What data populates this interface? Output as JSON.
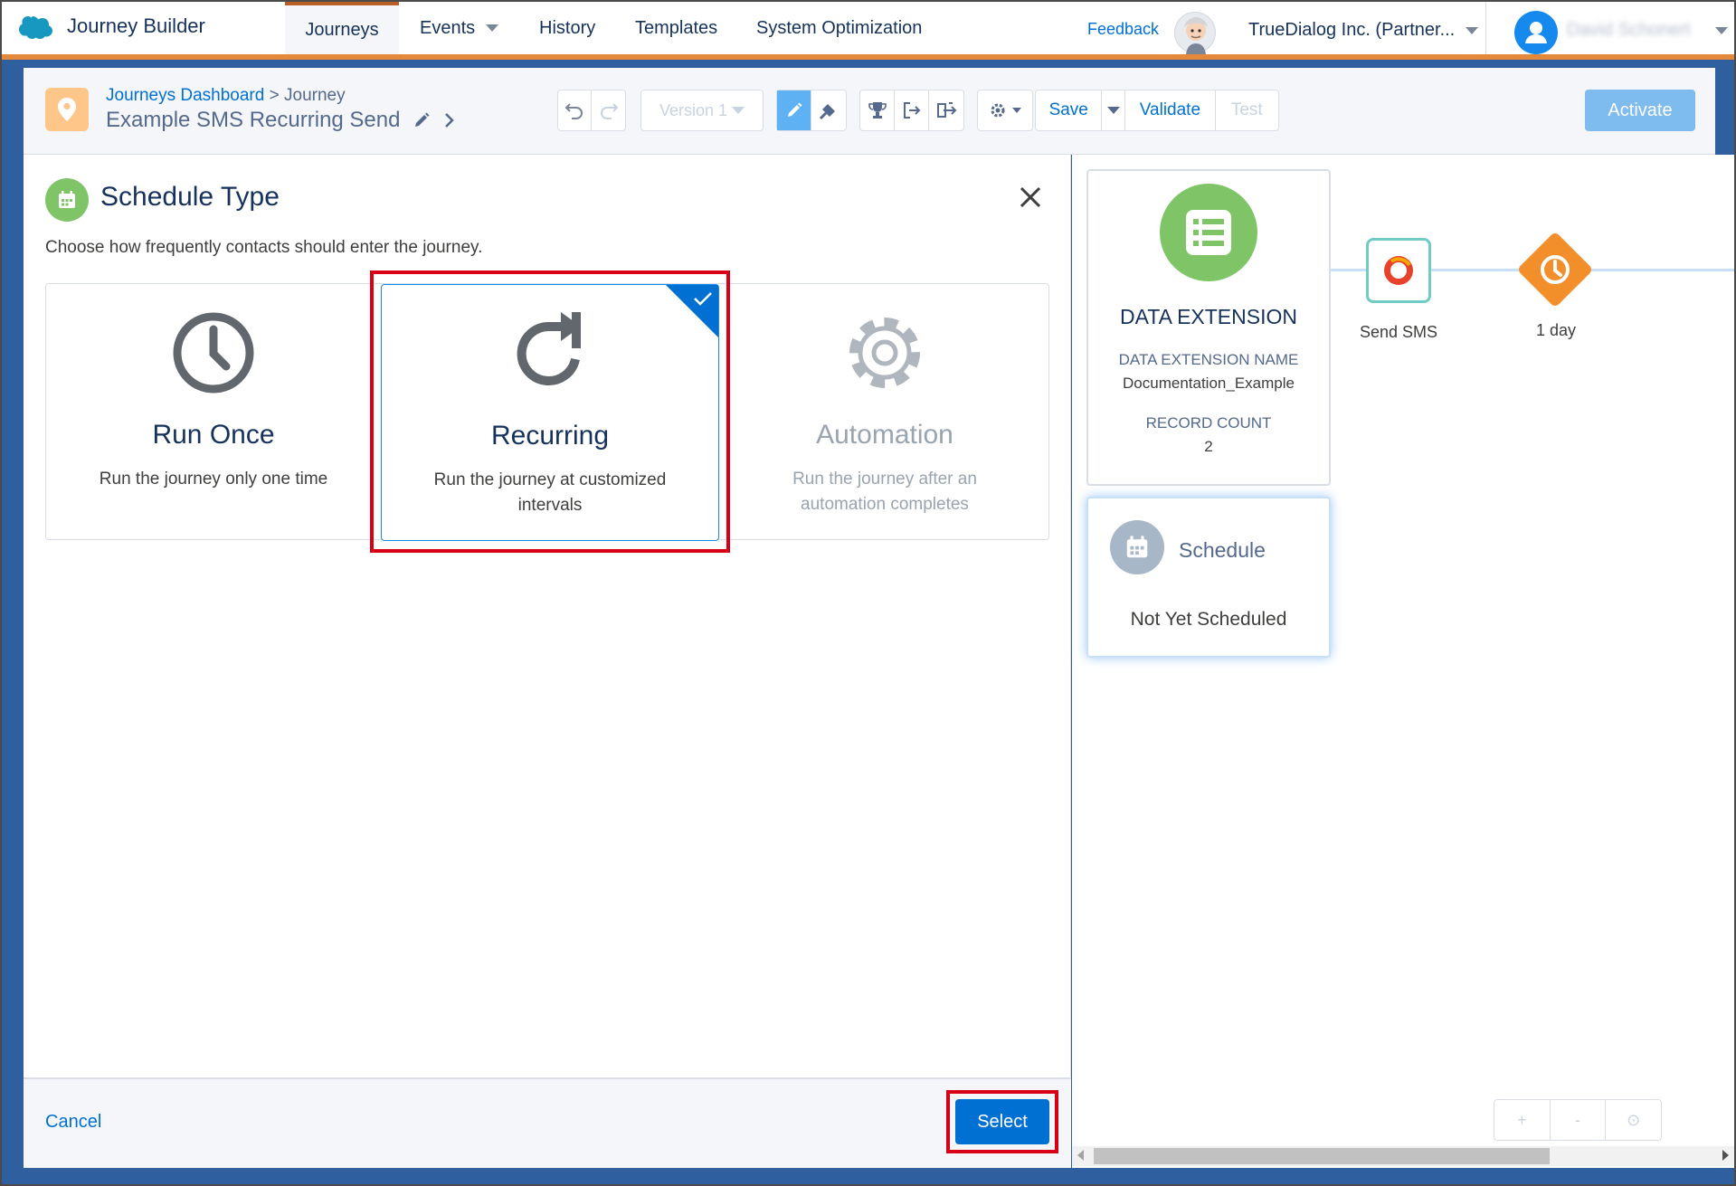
{
  "app": {
    "name": "Journey Builder"
  },
  "nav": {
    "tabs": [
      {
        "label": "Journeys"
      },
      {
        "label": "Events"
      },
      {
        "label": "History"
      },
      {
        "label": "Templates"
      },
      {
        "label": "System Optimization"
      }
    ],
    "feedback": "Feedback",
    "org": "TrueDialog Inc. (Partner...",
    "user": "David Schonert"
  },
  "toolbar": {
    "crumb_link": "Journeys Dashboard",
    "crumb_sep": ">",
    "crumb_current": "Journey",
    "journey_title": "Example SMS Recurring Send",
    "version": "Version 1",
    "save": "Save",
    "validate": "Validate",
    "test": "Test",
    "activate": "Activate"
  },
  "panel": {
    "title": "Schedule Type",
    "subtitle": "Choose how frequently contacts should enter the journey.",
    "options": [
      {
        "title": "Run Once",
        "desc": "Run the journey only one time",
        "icon": "clock-icon",
        "selected": false
      },
      {
        "title": "Recurring",
        "desc": "Run the journey at customized intervals",
        "icon": "recurring-arrow-icon",
        "selected": true
      },
      {
        "title": "Automation",
        "desc": "Run the journey after an automation completes",
        "icon": "gear-icon",
        "selected": false,
        "disabled": true
      }
    ],
    "cancel": "Cancel",
    "select": "Select"
  },
  "canvas": {
    "entry": {
      "title": "DATA EXTENSION",
      "name_label": "DATA EXTENSION NAME",
      "name_value": "Documentation_Example",
      "count_label": "RECORD COUNT",
      "count_value": "2"
    },
    "schedule": {
      "title": "Schedule",
      "status": "Not Yet Scheduled"
    },
    "activities": [
      {
        "label": "Send SMS"
      },
      {
        "label": "1 day"
      }
    ],
    "zoom": {
      "in": "+",
      "out": "-",
      "reset": "⊙"
    }
  },
  "colors": {
    "accent": "#0070d2",
    "nav_border": "#e4883a",
    "entry_green": "#7fc466",
    "wait_orange": "#f38f2b",
    "highlight_red": "#d80016"
  }
}
